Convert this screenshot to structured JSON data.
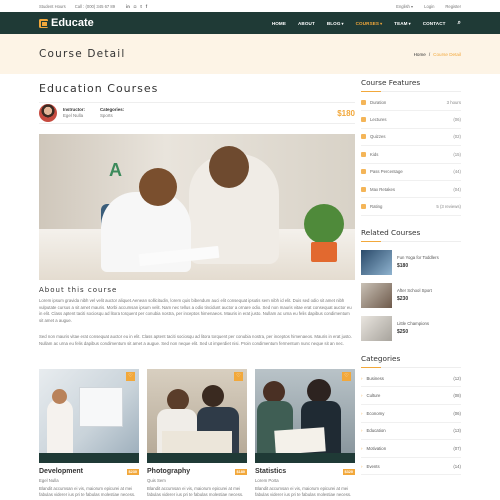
{
  "topbar": {
    "student_hours": "Student Hours",
    "call": "Call : (000) 345 67 89",
    "social": [
      "in",
      "◘",
      "t",
      "f"
    ],
    "language": "English",
    "login": "Login",
    "register": "Register"
  },
  "nav": {
    "logo": "Educate",
    "items": [
      "HOME",
      "ABOUT",
      "BLOG",
      "COURSES",
      "TEAM",
      "CONTACT"
    ],
    "active": "COURSES",
    "accent": "#f2a83b",
    "bg": "#1f3a36"
  },
  "band": {
    "title": "Course Detail",
    "crumb_home": "Home",
    "crumb_sep": "/",
    "crumb_current": "Course Detail"
  },
  "course": {
    "title": "Education Courses",
    "instructor_label": "Instructor:",
    "instructor": "Egel Nulla",
    "categories_label": "Categories:",
    "category": "Sports",
    "price": "$180",
    "about_title": "About this course",
    "para1": "Lorem ipsum gravida nibh vel velit auctor aliquet.Aenean sollicitudin, lorem quis bibendum auci elit consequat ipsutis sem nibh id elit. Duis sed odio sit amet nibh vulputate cursus a sit amet mauris. Morbi accumsan ipsum velit. Nam nec tellus a odio tincidunt auctor a ornare odio. Sed non mauris vitae erat consequat auctor eu in elit. Class aptent taciti sociosqu ad litora torquent per conubia nostra, per inceptos himenaeos. Mauris in erat justo. Nullam ac urna eu felis dapibus condimentum sit amet a augue.",
    "para2": "Sed non mauris vitae erat consequat auctor eu in elit. Class aptent taciti sociosqu ad litora torquent per conubia nostra, per inceptos himenaeos. Mauris in erat justo. Nullam ac urna eu felis dapibus condimentum sit amet a augue. Sed non neque elit. Sed ut imperdiet nisi. Proin condimentum fermentum nunc neque sit an nec."
  },
  "cards": [
    {
      "title": "Development",
      "price": "$230",
      "author": "Egel Nulla",
      "desc": "Blandit accumsan ei vis, maiorum epicurei at mei fabulas viderer ius pri te fabulas molestiae necess."
    },
    {
      "title": "Photography",
      "price": "$180",
      "author": "Quis Sem",
      "desc": "Blandit accumsan ei vis, maiorum epicurei at mei fabulas viderer ius pri te fabulas molestiae necess."
    },
    {
      "title": "Statistics",
      "price": "$320",
      "author": "Lorem Porta",
      "desc": "Blandit accumsan ei vis, maiorum epicurei at mei fabulas viderer ius pri te fabulas molestiae necess."
    }
  ],
  "features": {
    "title": "Course Features",
    "items": [
      {
        "label": "Duration",
        "value": "3 hours"
      },
      {
        "label": "Lectures",
        "value": "(06)"
      },
      {
        "label": "Quizzes",
        "value": "(02)"
      },
      {
        "label": "Kids",
        "value": "(15)"
      },
      {
        "label": "Pass Percentage",
        "value": "(44)"
      },
      {
        "label": "Max Retakes",
        "value": "(04)"
      },
      {
        "label": "Rating",
        "value": "5 (3 reviews)"
      }
    ]
  },
  "related": {
    "title": "Related Courses",
    "items": [
      {
        "title": "Fun Yoga for Toddlers",
        "price": "$180"
      },
      {
        "title": "After School Sport",
        "price": "$230"
      },
      {
        "title": "Little Champions",
        "price": "$250"
      }
    ]
  },
  "categories": {
    "title": "Categories",
    "items": [
      {
        "label": "Business",
        "count": "(12)"
      },
      {
        "label": "Culture",
        "count": "(08)"
      },
      {
        "label": "Economy",
        "count": "(06)"
      },
      {
        "label": "Education",
        "count": "(13)"
      },
      {
        "label": "Motivation",
        "count": "(07)"
      },
      {
        "label": "Events",
        "count": "(14)"
      }
    ]
  }
}
